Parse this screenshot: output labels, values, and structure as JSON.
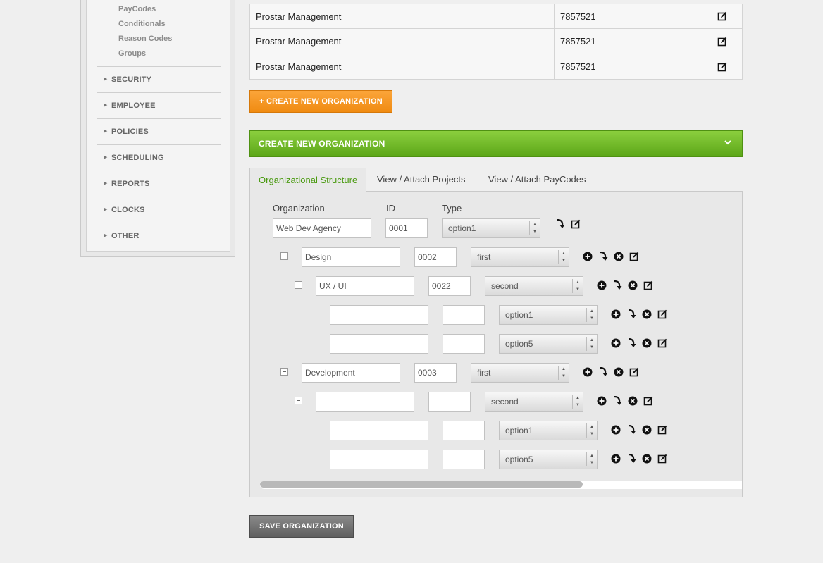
{
  "sidebar": {
    "sub_items": [
      "PayCodes",
      "Conditionals",
      "Reason Codes",
      "Groups"
    ],
    "nav_items": [
      "SECURITY",
      "EMPLOYEE",
      "POLICIES",
      "SCHEDULING",
      "REPORTS",
      "CLOCKS",
      "OTHER"
    ]
  },
  "table": {
    "rows": [
      {
        "name": "Prostar Management",
        "id": "7857521"
      },
      {
        "name": "Prostar Management",
        "id": "7857521"
      },
      {
        "name": "Prostar Management",
        "id": "7857521"
      }
    ]
  },
  "buttons": {
    "create_new": "+ CREATE NEW ORGANIZATION",
    "save": "SAVE ORGANIZATION"
  },
  "panel": {
    "title": "CREATE NEW ORGANIZATION"
  },
  "tabs": [
    "Organizational Structure",
    "View / Attach Projects",
    "View / Attach PayCodes"
  ],
  "form": {
    "labels": {
      "organization": "Organization",
      "id": "ID",
      "type": "Type"
    },
    "root": {
      "name": "Web Dev Agency",
      "id": "0001",
      "type": "option1"
    },
    "rows": [
      {
        "name": "Design",
        "id": "0002",
        "type": "first"
      },
      {
        "name": "UX / UI",
        "id": "0022",
        "type": "second"
      },
      {
        "name": "",
        "id": "",
        "type": "option1"
      },
      {
        "name": "",
        "id": "",
        "type": "option5"
      },
      {
        "name": "Development",
        "id": "0003",
        "type": "first"
      },
      {
        "name": "",
        "id": "",
        "type": "second"
      },
      {
        "name": "",
        "id": "",
        "type": "option1"
      },
      {
        "name": "",
        "id": "",
        "type": "option5"
      }
    ]
  },
  "colors": {
    "accent_green": "#5ca618",
    "accent_orange": "#f08b12",
    "active_tab_text": "#4a9a10"
  }
}
